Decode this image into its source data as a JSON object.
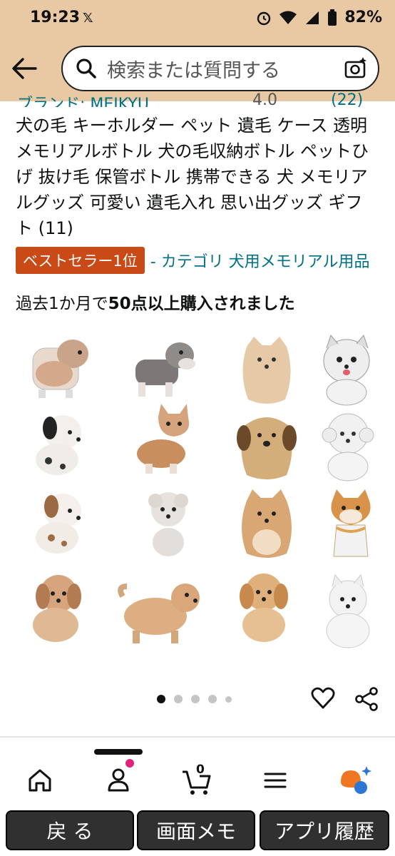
{
  "status": {
    "time": "19:23",
    "battery": "82%"
  },
  "search": {
    "placeholder": "検索または質問する"
  },
  "product": {
    "brand_cutoff": "ブランド: MEIKYU",
    "rating_cutoff": "4.0",
    "reviews_cutoff": "(22)",
    "title": "犬の毛 キーホルダー ペット 遺毛 ケース 透明 メモリアルボトル 犬の毛収納ボトル ペットひげ 抜け毛 保管ボトル 携帯できる 犬 メモリアルグッズ 可愛い 遺毛入れ 思い出グッズ ギフト (11)",
    "badge": "ベストセラー1位",
    "category": "- カテゴリ 犬用メモリアル用品",
    "bought_prefix": "過去1か月で",
    "bought_bold": "50点以上購入されました"
  },
  "carousel": {
    "total_dots": 5,
    "active_index": 0
  },
  "bottom_nav": {
    "items": [
      "home-icon",
      "account-icon",
      "cart-icon",
      "menu-icon",
      "rufus-icon"
    ],
    "cart_count": "0"
  },
  "system_buttons": {
    "back": "戻 る",
    "memo": "画面メモ",
    "history": "アプリ履歴"
  },
  "colors": {
    "header_bg": "#e8c9a3",
    "badge_bg": "#c94a16",
    "link": "#007185"
  }
}
